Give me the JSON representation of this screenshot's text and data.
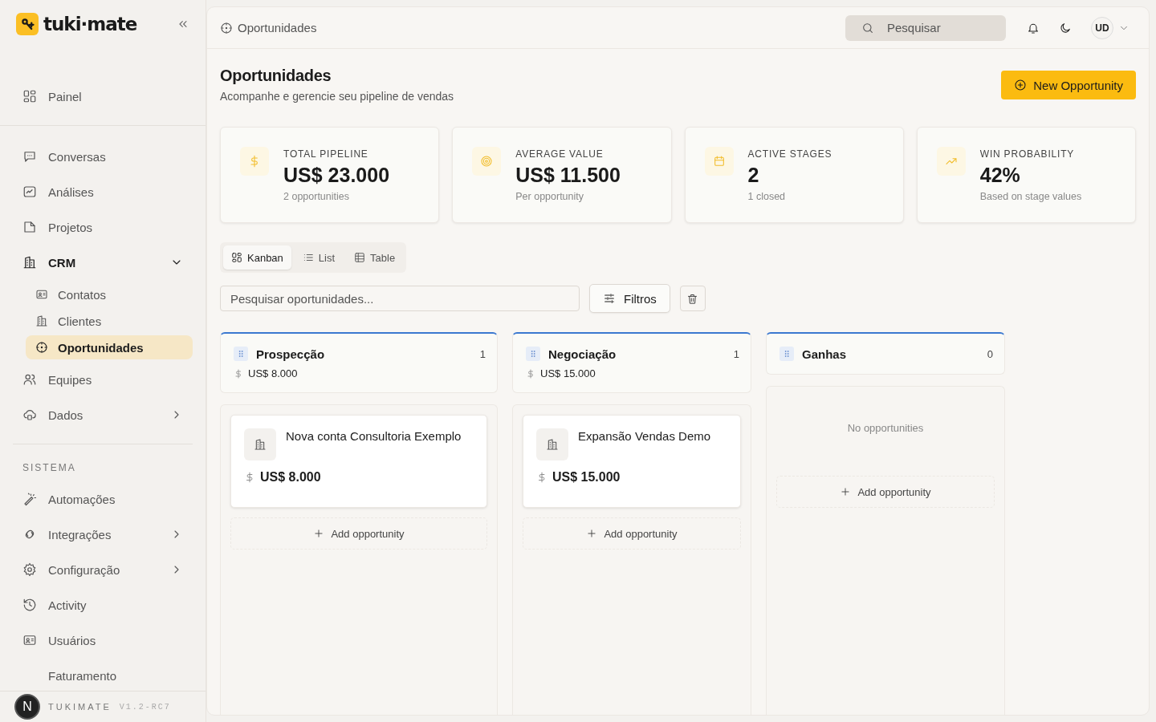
{
  "sidebar": {
    "logo": "tuki·mate",
    "top_items": [
      {
        "label": "Painel",
        "selected": false
      }
    ],
    "items": [
      {
        "label": "Conversas",
        "selected": false
      },
      {
        "label": "Análises",
        "selected": false
      },
      {
        "label": "Projetos",
        "selected": false
      },
      {
        "label": "CRM",
        "selected": false,
        "expanded": true,
        "children": [
          {
            "label": "Contatos",
            "selected": false
          },
          {
            "label": "Clientes",
            "selected": false
          },
          {
            "label": "Oportunidades",
            "selected": true
          }
        ]
      },
      {
        "label": "Equipes",
        "selected": false
      },
      {
        "label": "Dados",
        "selected": false,
        "expanded": false
      }
    ],
    "section_title": "SISTEMA",
    "system_items": [
      {
        "label": "Automações",
        "selected": false
      },
      {
        "label": "Integrações",
        "selected": false,
        "expanded": false
      },
      {
        "label": "Configuração",
        "selected": false,
        "expanded": false
      },
      {
        "label": "Activity",
        "selected": false
      },
      {
        "label": "Usuários",
        "selected": false
      },
      {
        "label": "Faturamento",
        "selected": false
      }
    ],
    "footer_brand": "TUKIMATE",
    "footer_version": "V1.2-RC7",
    "avatar_letter": "N"
  },
  "topbar": {
    "breadcrumb": "Oportunidades",
    "search": {
      "placeholder": "Pesquisar"
    },
    "user_initials": "UD"
  },
  "header": {
    "title": "Oportunidades",
    "subtitle": "Acompanhe e gerencie seu pipeline de vendas",
    "new_button": "New Opportunity"
  },
  "stats": [
    {
      "label": "TOTAL PIPELINE",
      "value": "US$ 23.000",
      "note": "2 opportunities"
    },
    {
      "label": "AVERAGE VALUE",
      "value": "US$ 11.500",
      "note": "Per opportunity"
    },
    {
      "label": "ACTIVE STAGES",
      "value": "2",
      "note": "1 closed"
    },
    {
      "label": "WIN PROBABILITY",
      "value": "42%",
      "note": "Based on stage values"
    }
  ],
  "view_tabs": [
    {
      "label": "Kanban",
      "selected": true
    },
    {
      "label": "List",
      "selected": false
    },
    {
      "label": "Table",
      "selected": false
    }
  ],
  "filter": {
    "placeholder": "Pesquisar oportunidades...",
    "button": "Filtros"
  },
  "columns": [
    {
      "name": "Prospecção",
      "count": "1",
      "total": "US$ 8.000",
      "cards": [
        {
          "title": "Nova conta Consultoria Exemplo",
          "amount": "US$ 8.000"
        }
      ],
      "add": "Add opportunity"
    },
    {
      "name": "Negociação",
      "count": "1",
      "total": "US$ 15.000",
      "cards": [
        {
          "title": "Expansão Vendas Demo",
          "amount": "US$ 15.000"
        }
      ],
      "add": "Add opportunity"
    },
    {
      "name": "Ganhas",
      "count": "0",
      "empty_text": "No opportunities",
      "add": "Add opportunity"
    }
  ]
}
